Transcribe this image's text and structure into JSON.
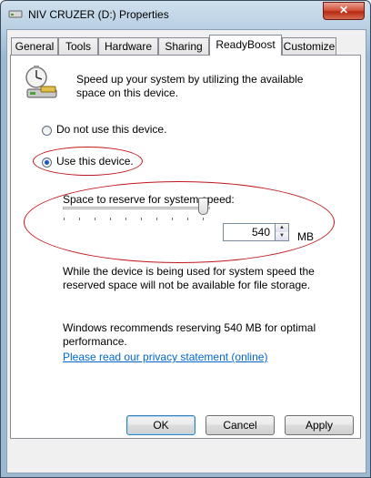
{
  "window": {
    "title": "NIV CRUZER (D:) Properties",
    "close_label": "✕"
  },
  "tabs": [
    "General",
    "Tools",
    "Hardware",
    "Sharing",
    "ReadyBoost",
    "Customize"
  ],
  "readyboost": {
    "intro": "Speed up your system by utilizing the available space on this device.",
    "option_do_not_use": "Do not use this device.",
    "option_use": "Use this device.",
    "selected_option": "Use this device.",
    "reserve_label": "Space to reserve for system speed:",
    "reserve_value": "540",
    "unit": "MB",
    "slider_fraction": 0.93,
    "note": "While the device is being used for system speed the reserved space will not be available for file storage.",
    "recommendation": "Windows recommends reserving 540 MB for optimal performance.",
    "privacy_link": "Please read our privacy statement (online)"
  },
  "buttons": {
    "ok": "OK",
    "cancel": "Cancel",
    "apply": "Apply"
  },
  "colors": {
    "annotation": "#c0151b",
    "link": "#0066cc",
    "radio_selected": "#1a5bb5"
  },
  "icons": {
    "device": "usb-drive-icon",
    "title": "drive-icon"
  }
}
